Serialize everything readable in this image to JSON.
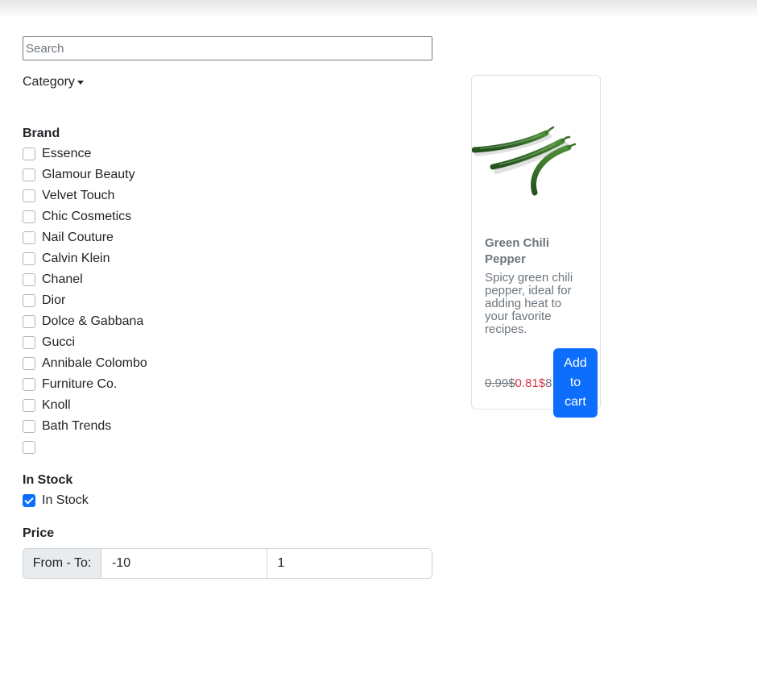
{
  "search": {
    "placeholder": "Search",
    "value": ""
  },
  "category": {
    "label": "Category"
  },
  "brand": {
    "title": "Brand",
    "items": [
      {
        "label": "Essence",
        "checked": false
      },
      {
        "label": "Glamour Beauty",
        "checked": false
      },
      {
        "label": "Velvet Touch",
        "checked": false
      },
      {
        "label": "Chic Cosmetics",
        "checked": false
      },
      {
        "label": "Nail Couture",
        "checked": false
      },
      {
        "label": "Calvin Klein",
        "checked": false
      },
      {
        "label": "Chanel",
        "checked": false
      },
      {
        "label": "Dior",
        "checked": false
      },
      {
        "label": "Dolce & Gabbana",
        "checked": false
      },
      {
        "label": "Gucci",
        "checked": false
      },
      {
        "label": "Annibale Colombo",
        "checked": false
      },
      {
        "label": "Furniture Co.",
        "checked": false
      },
      {
        "label": "Knoll",
        "checked": false
      },
      {
        "label": "Bath Trends",
        "checked": false
      },
      {
        "label": "",
        "checked": false
      }
    ]
  },
  "stock": {
    "title": "In Stock",
    "option": {
      "label": "In Stock",
      "checked": true
    }
  },
  "price": {
    "title": "Price",
    "range_label": "From - To:",
    "from": "-10",
    "to": "1"
  },
  "product": {
    "image_icon": "green-chili-image",
    "title": "Green Chili Pepper",
    "description": "Spicy green chili pepper, ideal for adding heat to your favorite recipes.",
    "old_price": "0.99$",
    "new_price": "0.81$",
    "price_tail": "8",
    "add_to_cart": "Add to cart"
  },
  "colors": {
    "accent": "#0d6efd",
    "sale": "#dc3545",
    "muted": "#6c757d"
  }
}
